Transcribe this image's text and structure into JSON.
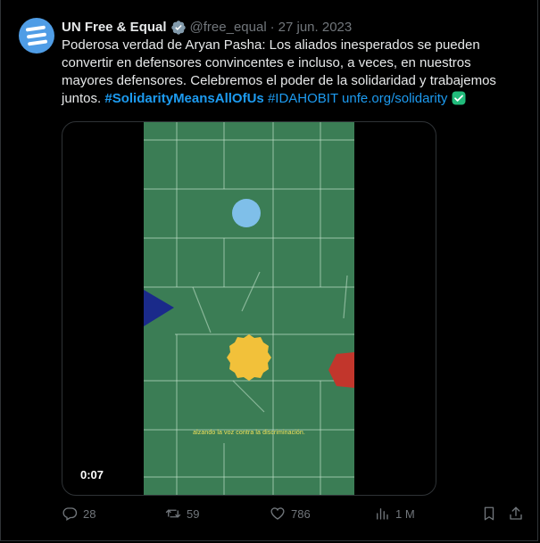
{
  "author": {
    "display_name": "UN Free & Equal",
    "handle": "@free_equal",
    "separator": "·",
    "date": "27 jun. 2023",
    "avatar_icon": "un-free-equal-logo-icon",
    "verified_icon": "verified-badge-icon"
  },
  "tweet": {
    "text_plain": "Poderosa verdad de Aryan Pasha: Los aliados inesperados se pueden convertir en defensores convincentes e incluso, a veces, en nuestros mayores defensores. Celebremos el poder de la solidaridad y trabajemos juntos. ",
    "hashtag_1": "#SolidarityMeansAllOfUs",
    "hashtag_2": "#IDAHOBIT",
    "link": "unfe.org/solidarity",
    "emoji_icon": "check-mark-icon"
  },
  "media": {
    "subtitle": "alzando la voz contra la discriminación.",
    "timestamp": "0:07"
  },
  "actions": {
    "replies": "28",
    "reposts": "59",
    "likes": "786",
    "views": "1 M"
  },
  "colors": {
    "accent": "#1d9bf0",
    "secondary_text": "#71767b",
    "video_green": "#3b7d55",
    "check_green": "#21bb7b"
  }
}
